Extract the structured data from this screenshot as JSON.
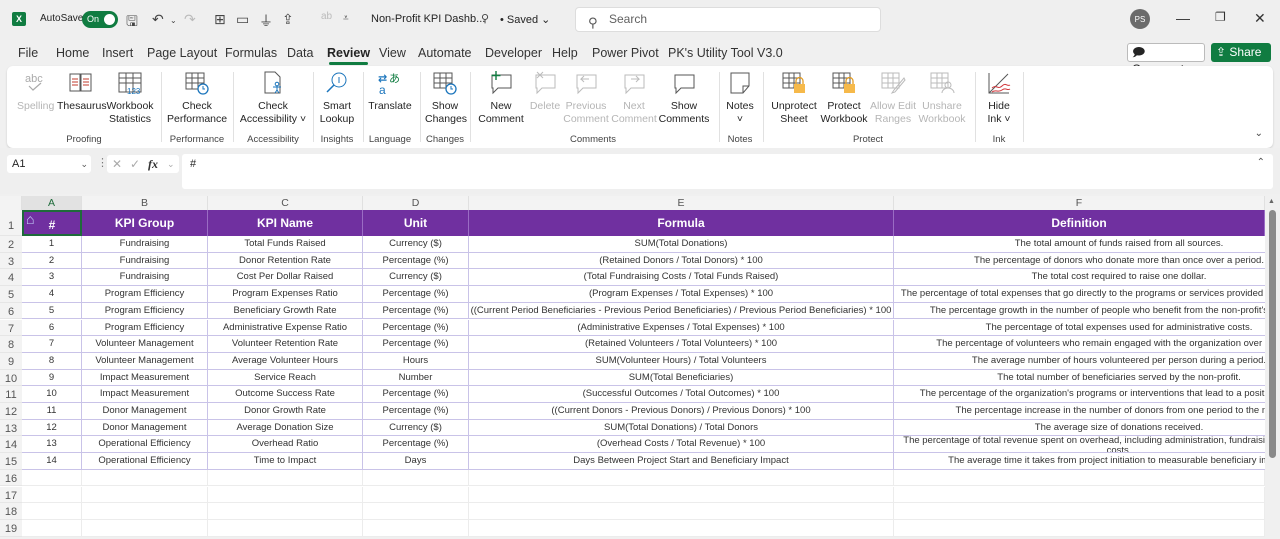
{
  "titlebar": {
    "app_icon": "excel-icon",
    "autosave_label": "AutoSave",
    "autosave_state": "On",
    "doc_title": "Non-Profit KPI Dashb...",
    "saved_status": "• Saved",
    "search_placeholder": "Search",
    "user_initials": "PS"
  },
  "menu": {
    "tabs": [
      "File",
      "Home",
      "Insert",
      "Page Layout",
      "Formulas",
      "Data",
      "Review",
      "View",
      "Automate",
      "Developer",
      "Help",
      "Power Pivot",
      "PK's Utility Tool V3.0"
    ],
    "active": "Review",
    "comments_label": "Comments",
    "share_label": "Share"
  },
  "ribbon": {
    "groups": [
      {
        "label": "Proofing",
        "buttons": [
          {
            "label": "Spelling",
            "icon": "spelling-icon",
            "disabled": true
          },
          {
            "label": "Thesaurus",
            "icon": "thesaurus-icon"
          },
          {
            "label": "Workbook Statistics",
            "icon": "workbook-statistics-icon"
          }
        ]
      },
      {
        "label": "Performance",
        "buttons": [
          {
            "label": "Check Performance",
            "icon": "check-performance-icon"
          }
        ]
      },
      {
        "label": "Accessibility",
        "buttons": [
          {
            "label": "Check Accessibility ˅",
            "icon": "check-accessibility-icon"
          }
        ]
      },
      {
        "label": "Insights",
        "buttons": [
          {
            "label": "Smart Lookup",
            "icon": "smart-lookup-icon"
          }
        ]
      },
      {
        "label": "Language",
        "buttons": [
          {
            "label": "Translate",
            "icon": "translate-icon"
          }
        ]
      },
      {
        "label": "Changes",
        "buttons": [
          {
            "label": "Show Changes",
            "icon": "show-changes-icon"
          }
        ]
      },
      {
        "label": "Comments",
        "buttons": [
          {
            "label": "New Comment",
            "icon": "new-comment-icon"
          },
          {
            "label": "Delete",
            "icon": "delete-comment-icon",
            "disabled": true
          },
          {
            "label": "Previous Comment",
            "icon": "previous-comment-icon",
            "disabled": true
          },
          {
            "label": "Next Comment",
            "icon": "next-comment-icon",
            "disabled": true
          },
          {
            "label": "Show Comments",
            "icon": "show-comments-icon"
          }
        ]
      },
      {
        "label": "Notes",
        "buttons": [
          {
            "label": "Notes ˅",
            "icon": "notes-icon"
          }
        ]
      },
      {
        "label": "Protect",
        "buttons": [
          {
            "label": "Unprotect Sheet",
            "icon": "unprotect-sheet-icon"
          },
          {
            "label": "Protect Workbook",
            "icon": "protect-workbook-icon"
          },
          {
            "label": "Allow Edit Ranges",
            "icon": "allow-edit-ranges-icon",
            "disabled": true
          },
          {
            "label": "Unshare Workbook",
            "icon": "unshare-workbook-icon",
            "disabled": true
          }
        ]
      },
      {
        "label": "Ink",
        "buttons": [
          {
            "label": "Hide Ink ˅",
            "icon": "hide-ink-icon"
          }
        ]
      }
    ]
  },
  "formula_bar": {
    "name_box": "A1",
    "formula": "#"
  },
  "sheet": {
    "columns": [
      "A",
      "B",
      "C",
      "D",
      "E",
      "F"
    ],
    "selected_column": "A",
    "header_fill": "#7030a0",
    "headers": [
      "#",
      "KPI Group",
      "KPI Name",
      "Unit",
      "Formula",
      "Definition"
    ],
    "rows": [
      [
        "1",
        "Fundraising",
        "Total Funds Raised",
        "Currency ($)",
        "SUM(Total Donations)",
        "The total amount of funds raised from all sources."
      ],
      [
        "2",
        "Fundraising",
        "Donor Retention Rate",
        "Percentage (%)",
        "(Retained Donors / Total Donors) * 100",
        "The percentage of donors who donate more than once over a period."
      ],
      [
        "3",
        "Fundraising",
        "Cost Per Dollar Raised",
        "Currency ($)",
        "(Total Fundraising Costs / Total Funds Raised)",
        "The total cost required to raise one dollar."
      ],
      [
        "4",
        "Program Efficiency",
        "Program Expenses Ratio",
        "Percentage (%)",
        "(Program Expenses / Total Expenses) * 100",
        "The percentage of total expenses that go directly to the programs or services provided by the non-profit."
      ],
      [
        "5",
        "Program Efficiency",
        "Beneficiary Growth Rate",
        "Percentage (%)",
        "((Current Period Beneficiaries - Previous Period Beneficiaries) / Previous Period Beneficiaries) * 100",
        "The percentage growth in the number of people who benefit from the non-profit's services."
      ],
      [
        "6",
        "Program Efficiency",
        "Administrative Expense Ratio",
        "Percentage (%)",
        "(Administrative Expenses / Total Expenses) * 100",
        "The percentage of total expenses used for administrative costs."
      ],
      [
        "7",
        "Volunteer Management",
        "Volunteer Retention Rate",
        "Percentage (%)",
        "(Retained Volunteers / Total Volunteers) * 100",
        "The percentage of volunteers who remain engaged with the organization over a period."
      ],
      [
        "8",
        "Volunteer Management",
        "Average Volunteer Hours",
        "Hours",
        "SUM(Volunteer Hours) / Total Volunteers",
        "The average number of hours volunteered per person during a period."
      ],
      [
        "9",
        "Impact Measurement",
        "Service Reach",
        "Number",
        "SUM(Total Beneficiaries)",
        "The total number of beneficiaries served by the non-profit."
      ],
      [
        "10",
        "Impact Measurement",
        "Outcome Success Rate",
        "Percentage (%)",
        "(Successful Outcomes / Total Outcomes) * 100",
        "The percentage of the organization's programs or interventions that lead to a positive outcome."
      ],
      [
        "11",
        "Donor Management",
        "Donor Growth Rate",
        "Percentage (%)",
        "((Current Donors - Previous Donors) / Previous Donors) * 100",
        "The percentage increase in the number of donors from one period to the next."
      ],
      [
        "12",
        "Donor Management",
        "Average Donation Size",
        "Currency ($)",
        "SUM(Total Donations) / Total Donors",
        "The average size of donations received."
      ],
      [
        "13",
        "Operational Efficiency",
        "Overhead Ratio",
        "Percentage (%)",
        "(Overhead Costs / Total Revenue) * 100",
        "The percentage of total revenue spent on overhead, including administration, fundraising, and program costs."
      ],
      [
        "14",
        "Operational Efficiency",
        "Time to Impact",
        "Days",
        "Days Between Project Start and Beneficiary Impact",
        "The average time it takes from project initiation to measurable beneficiary impact."
      ]
    ],
    "row_numbers": [
      "1",
      "2",
      "3",
      "4",
      "5",
      "6",
      "7",
      "8",
      "9",
      "10",
      "11",
      "12",
      "13",
      "14",
      "15",
      "16",
      "17",
      "18",
      "19"
    ]
  }
}
